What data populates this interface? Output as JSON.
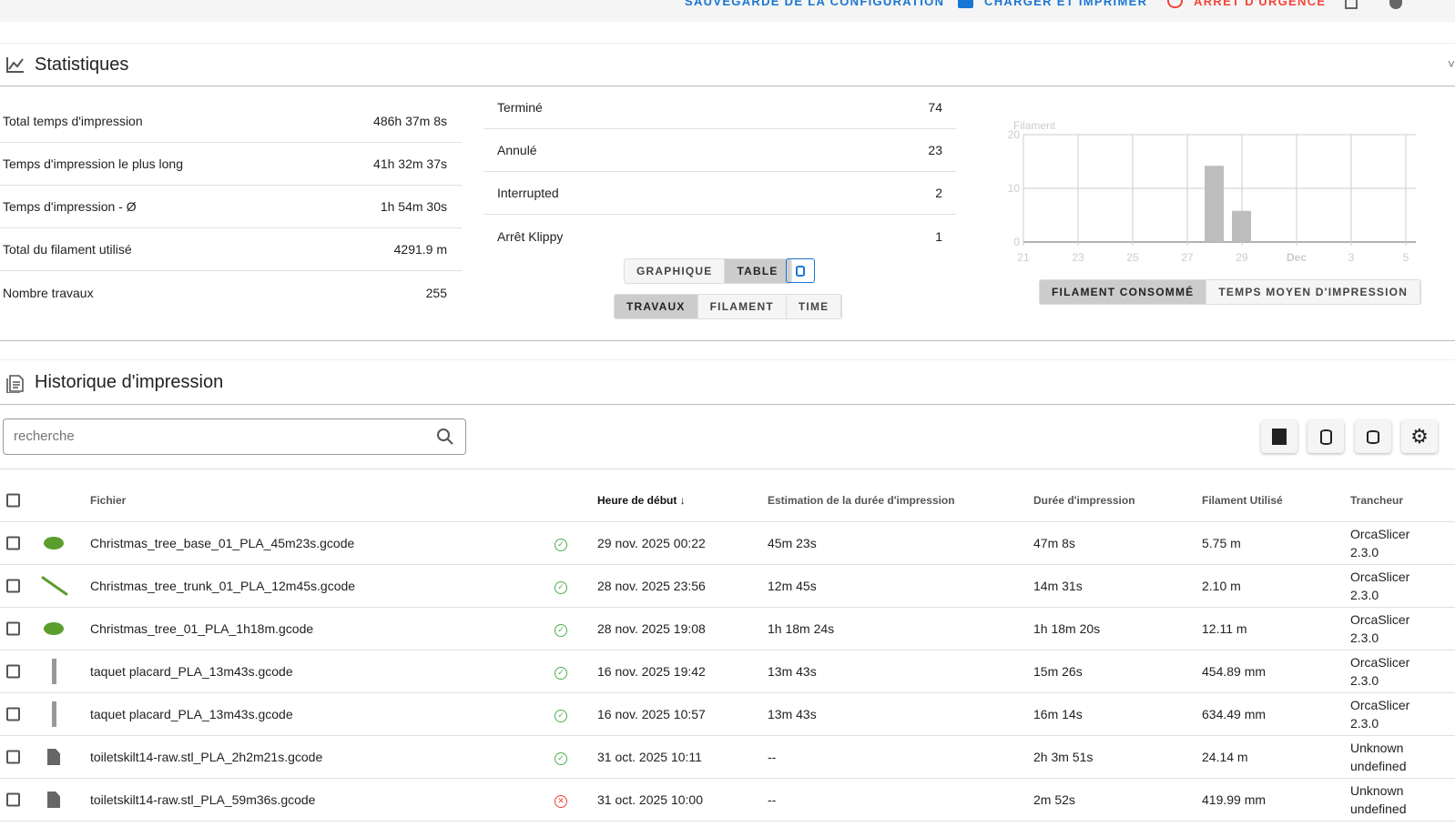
{
  "topbar": {
    "save_config": "SAUVEGARDE DE LA CONFIGURATION",
    "upload_print": "CHARGER ET IMPRIMER",
    "emergency_stop": "ARRÊT D'URGENCE"
  },
  "stats": {
    "title": "Statistiques",
    "left": [
      {
        "label": "Total temps d'impression",
        "value": "486h 37m 8s"
      },
      {
        "label": "Temps d'impression le plus long",
        "value": "41h 32m 37s"
      },
      {
        "label": "Temps d'impression - Ø",
        "value": "1h 54m 30s"
      },
      {
        "label": "Total du filament utilisé",
        "value": "4291.9 m"
      },
      {
        "label": "Nombre travaux",
        "value": "255"
      }
    ],
    "middle": [
      {
        "label": "Terminé",
        "value": "74"
      },
      {
        "label": "Annulé",
        "value": "23"
      },
      {
        "label": "Interrupted",
        "value": "2"
      },
      {
        "label": "Arrêt Klippy",
        "value": "1"
      }
    ],
    "view_toggle": [
      "GRAPHIQUE",
      "TABLE"
    ],
    "view_selected": "TABLE",
    "data_toggle": [
      "TRAVAUX",
      "FILAMENT",
      "TIME"
    ],
    "data_selected": "TRAVAUX",
    "chart_toggle": [
      "FILAMENT CONSOMMÉ",
      "TEMPS MOYEN D'IMPRESSION"
    ],
    "chart_selected": "FILAMENT CONSOMMÉ"
  },
  "chart_data": {
    "type": "bar",
    "ylabel": "Filament",
    "ylim": [
      0,
      20
    ],
    "yticks": [
      "0",
      "10",
      "20"
    ],
    "xticks": [
      "21",
      "23",
      "25",
      "27",
      "29",
      "Dec",
      "3",
      "5"
    ],
    "x": [
      "2025-11-28",
      "2025-11-29"
    ],
    "values": [
      14.2,
      5.8
    ],
    "grid": true,
    "bar_color": "#bdbdbd"
  },
  "history": {
    "title": "Historique d'impression",
    "search_placeholder": "recherche",
    "columns": [
      "Fichier",
      "Heure de début",
      "Estimation de la durée d'impression",
      "Durée d'impression",
      "Filament Utilisé",
      "Trancheur"
    ],
    "rows": [
      {
        "file": "Christmas_tree_base_01_PLA_45m23s.gcode",
        "status": "completed",
        "start": "29 nov. 2025 00:22",
        "estimate": "45m 23s",
        "duration": "47m 8s",
        "filament": "5.75 m",
        "slicer": "OrcaSlicer",
        "slicer_version": "2.3.0",
        "thumb": "green-disc"
      },
      {
        "file": "Christmas_tree_trunk_01_PLA_12m45s.gcode",
        "status": "completed",
        "start": "28 nov. 2025 23:56",
        "estimate": "12m 45s",
        "duration": "14m 31s",
        "filament": "2.10 m",
        "slicer": "OrcaSlicer",
        "slicer_version": "2.3.0",
        "thumb": "green-stick"
      },
      {
        "file": "Christmas_tree_01_PLA_1h18m.gcode",
        "status": "completed",
        "start": "28 nov. 2025 19:08",
        "estimate": "1h 18m 24s",
        "duration": "1h 18m 20s",
        "filament": "12.11 m",
        "slicer": "OrcaSlicer",
        "slicer_version": "2.3.0",
        "thumb": "green-disc"
      },
      {
        "file": "taquet placard_PLA_13m43s.gcode",
        "status": "completed",
        "start": "16 nov. 2025 19:42",
        "estimate": "13m 43s",
        "duration": "15m 26s",
        "filament": "454.89 mm",
        "slicer": "OrcaSlicer",
        "slicer_version": "2.3.0",
        "thumb": "grey-peg"
      },
      {
        "file": "taquet placard_PLA_13m43s.gcode",
        "status": "completed",
        "start": "16 nov. 2025 10:57",
        "estimate": "13m 43s",
        "duration": "16m 14s",
        "filament": "634.49 mm",
        "slicer": "OrcaSlicer",
        "slicer_version": "2.3.0",
        "thumb": "grey-peg"
      },
      {
        "file": "toiletskilt14-raw.stl_PLA_2h2m21s.gcode",
        "status": "completed",
        "start": "31 oct. 2025 10:11",
        "estimate": "--",
        "duration": "2h 3m 51s",
        "filament": "24.14 m",
        "slicer": "Unknown",
        "slicer_version": "undefined",
        "thumb": "file"
      },
      {
        "file": "toiletskilt14-raw.stl_PLA_59m36s.gcode",
        "status": "cancelled",
        "start": "31 oct. 2025 10:00",
        "estimate": "--",
        "duration": "2m 52s",
        "filament": "419.99 mm",
        "slicer": "Unknown",
        "slicer_version": "undefined",
        "thumb": "file"
      }
    ]
  },
  "colors": {
    "accent": "#1976d2",
    "danger": "#f44336",
    "success": "#4caf50"
  }
}
